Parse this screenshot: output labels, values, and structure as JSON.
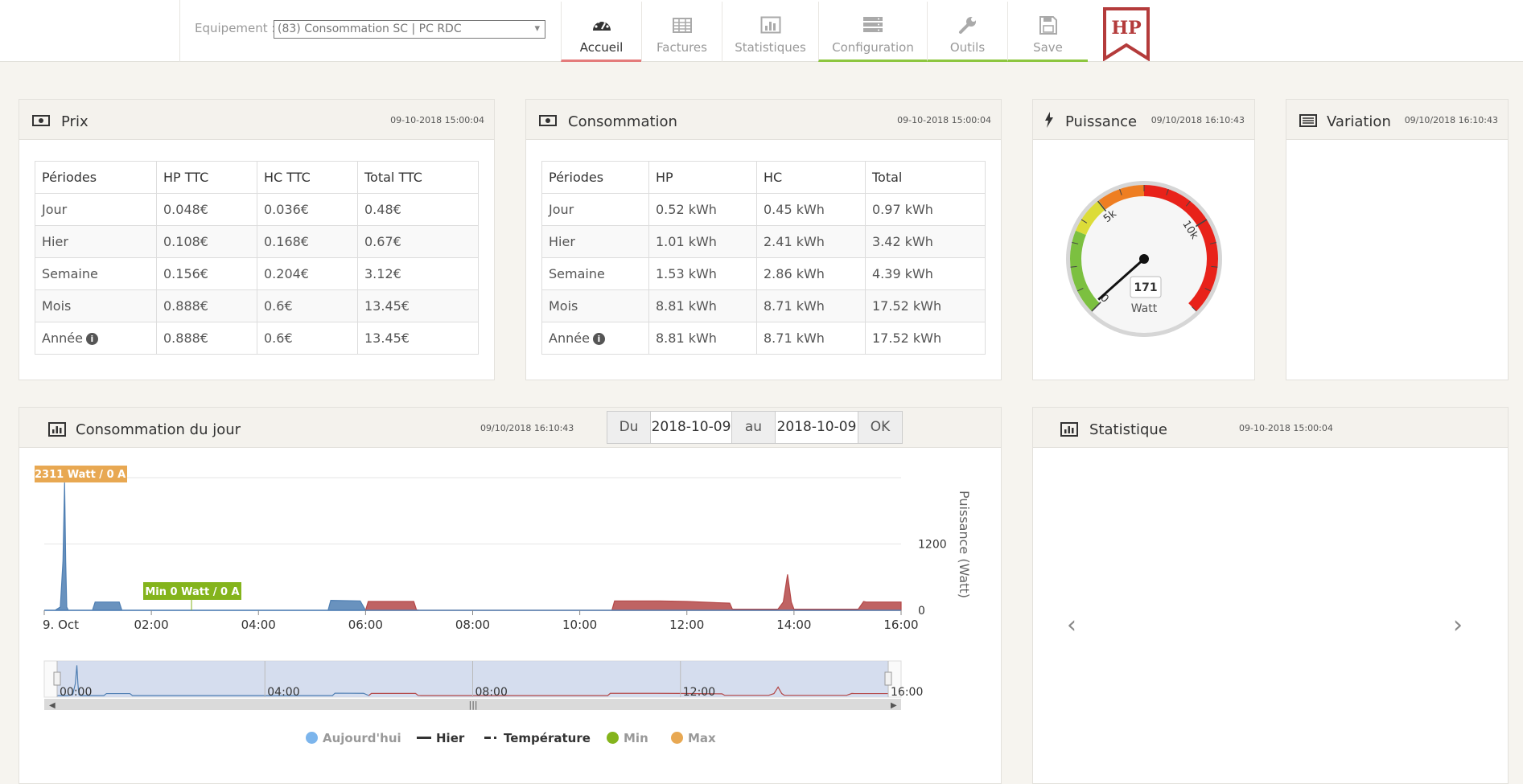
{
  "toolbar": {
    "equip_label": "Equipement :",
    "equip_value": "(83) Consommation SC | PC RDC",
    "tabs": [
      {
        "label": "Accueil",
        "icon": "dashboard-icon"
      },
      {
        "label": "Factures",
        "icon": "table-icon"
      },
      {
        "label": "Statistiques",
        "icon": "bar-chart-icon"
      },
      {
        "label": "Configuration",
        "icon": "server-icon"
      },
      {
        "label": "Outils",
        "icon": "wrench-icon"
      },
      {
        "label": "Save",
        "icon": "floppy-icon"
      }
    ],
    "logo_text": "HP"
  },
  "prix": {
    "title": "Prix",
    "date": "09-10-2018 15:00:04",
    "headers": [
      "Périodes",
      "HP TTC",
      "HC TTC",
      "Total TTC"
    ],
    "rows": [
      [
        "Jour",
        "0.048€",
        "0.036€",
        "0.48€"
      ],
      [
        "Hier",
        "0.108€",
        "0.168€",
        "0.67€"
      ],
      [
        "Semaine",
        "0.156€",
        "0.204€",
        "3.12€"
      ],
      [
        "Mois",
        "0.888€",
        "0.6€",
        "13.45€"
      ],
      [
        "Année",
        "0.888€",
        "0.6€",
        "13.45€"
      ]
    ]
  },
  "consommation": {
    "title": "Consommation",
    "date": "09-10-2018 15:00:04",
    "headers": [
      "Périodes",
      "HP",
      "HC",
      "Total"
    ],
    "rows": [
      [
        "Jour",
        "0.52 kWh",
        "0.45 kWh",
        "0.97 kWh"
      ],
      [
        "Hier",
        "1.01 kWh",
        "2.41 kWh",
        "3.42 kWh"
      ],
      [
        "Semaine",
        "1.53 kWh",
        "2.86 kWh",
        "4.39 kWh"
      ],
      [
        "Mois",
        "8.81 kWh",
        "8.71 kWh",
        "17.52 kWh"
      ],
      [
        "Année",
        "8.81 kWh",
        "8.71 kWh",
        "17.52 kWh"
      ]
    ]
  },
  "puissance": {
    "title": "Puissance",
    "date": "09/10/2018 16:10:43",
    "gauge": {
      "value": 171,
      "unit": "Watt",
      "min": 0,
      "max": 14000,
      "ticks": [
        "0",
        "5k",
        "10k"
      ]
    }
  },
  "variation": {
    "title": "Variation",
    "date": "09/10/2018 16:10:43"
  },
  "jour": {
    "title": "Consommation du jour",
    "date": "09/10/2018 16:10:43",
    "du_label": "Du",
    "du_value": "2018-10-09",
    "au_label": "au",
    "au_value": "2018-10-09",
    "ok_label": "OK"
  },
  "statistique": {
    "title": "Statistique",
    "date": "09-10-2018 15:00:04"
  },
  "chart_data": {
    "type": "area",
    "xlabel": "",
    "ylabel": "Puissance (Watt)",
    "ylim": [
      0,
      2400
    ],
    "x_ticks": [
      "9. Oct",
      "02:00",
      "04:00",
      "06:00",
      "08:00",
      "10:00",
      "12:00",
      "14:00",
      "16:00"
    ],
    "y_ticks": [
      0,
      1200
    ],
    "navigator_ticks": [
      "00:00",
      "04:00",
      "08:00",
      "12:00",
      "16:00"
    ],
    "series": [
      {
        "name": "Aujourd'hui",
        "color": "#4f7fb3",
        "x": [
          0,
          0.2,
          0.3,
          0.35,
          0.38,
          0.4,
          0.42,
          0.45,
          0.5,
          0.9,
          0.95,
          1.0,
          1.4,
          1.45,
          1.5,
          2.0,
          2.5,
          3.0,
          3.5,
          4.0,
          4.5,
          5.0,
          5.3,
          5.35,
          5.9,
          6.0
        ],
        "y": [
          0,
          0,
          60,
          900,
          2311,
          900,
          60,
          0,
          0,
          0,
          150,
          150,
          150,
          0,
          0,
          0,
          0,
          0,
          0,
          0,
          0,
          0,
          0,
          180,
          170,
          0
        ]
      },
      {
        "name": "Hier",
        "color": "#b44848",
        "x": [
          6.0,
          6.05,
          6.9,
          6.95,
          7.0,
          9.5,
          10.0,
          10.6,
          10.65,
          11.5,
          12.0,
          12.5,
          12.8,
          12.85,
          13.7,
          13.8,
          13.88,
          13.95,
          14.0,
          15.2,
          15.3,
          15.35,
          16.0
        ],
        "y": [
          0,
          160,
          160,
          10,
          0,
          0,
          0,
          0,
          170,
          170,
          160,
          140,
          130,
          20,
          20,
          150,
          650,
          150,
          20,
          20,
          160,
          150,
          150
        ]
      },
      {
        "name": "Température",
        "color": "#333333",
        "x": [],
        "y": []
      },
      {
        "name": "Min",
        "color": "#84b41c",
        "x": [
          2.75
        ],
        "y": [
          0
        ]
      },
      {
        "name": "Max",
        "color": "#e8a852",
        "x": [
          0.38
        ],
        "y": [
          2311
        ]
      }
    ],
    "annotations": [
      {
        "text": "2311 Watt / 0 A",
        "series": "Max"
      },
      {
        "text": "Min 0 Watt / 0 A",
        "series": "Min"
      }
    ],
    "legend_position": "bottom"
  }
}
